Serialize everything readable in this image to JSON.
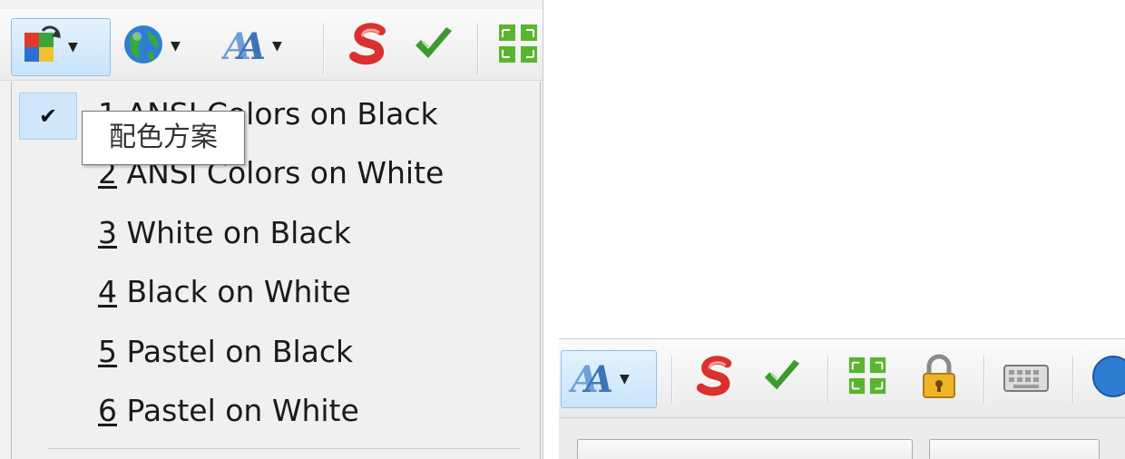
{
  "menu": {
    "items": [
      {
        "number": "1",
        "label": " ANSI Colors on Black",
        "checked": true
      },
      {
        "number": "2",
        "label": " ANSI Colors on White",
        "checked": false
      },
      {
        "number": "3",
        "label": " White on Black",
        "checked": false
      },
      {
        "number": "4",
        "label": " Black on White",
        "checked": false
      },
      {
        "number": "5",
        "label": " Pastel on Black",
        "checked": false
      },
      {
        "number": "6",
        "label": " Pastel on White",
        "checked": false
      }
    ],
    "check_glyph": "✔"
  },
  "tooltip": {
    "text": "配色方案"
  },
  "toolbar": {
    "dropdown_glyph": "▼",
    "buttons": [
      {
        "icon": "color-scheme-icon"
      },
      {
        "icon": "globe-icon"
      },
      {
        "icon": "font-icon"
      },
      {
        "icon": "red-s-icon"
      },
      {
        "icon": "green-check-icon"
      },
      {
        "icon": "grid-arrows-icon"
      },
      {
        "icon": "lock-icon"
      },
      {
        "icon": "keyboard-icon"
      },
      {
        "icon": "help-icon"
      }
    ]
  },
  "colors": {
    "highlight": "#cfe6fb",
    "accent_border": "#8fc0ea"
  }
}
